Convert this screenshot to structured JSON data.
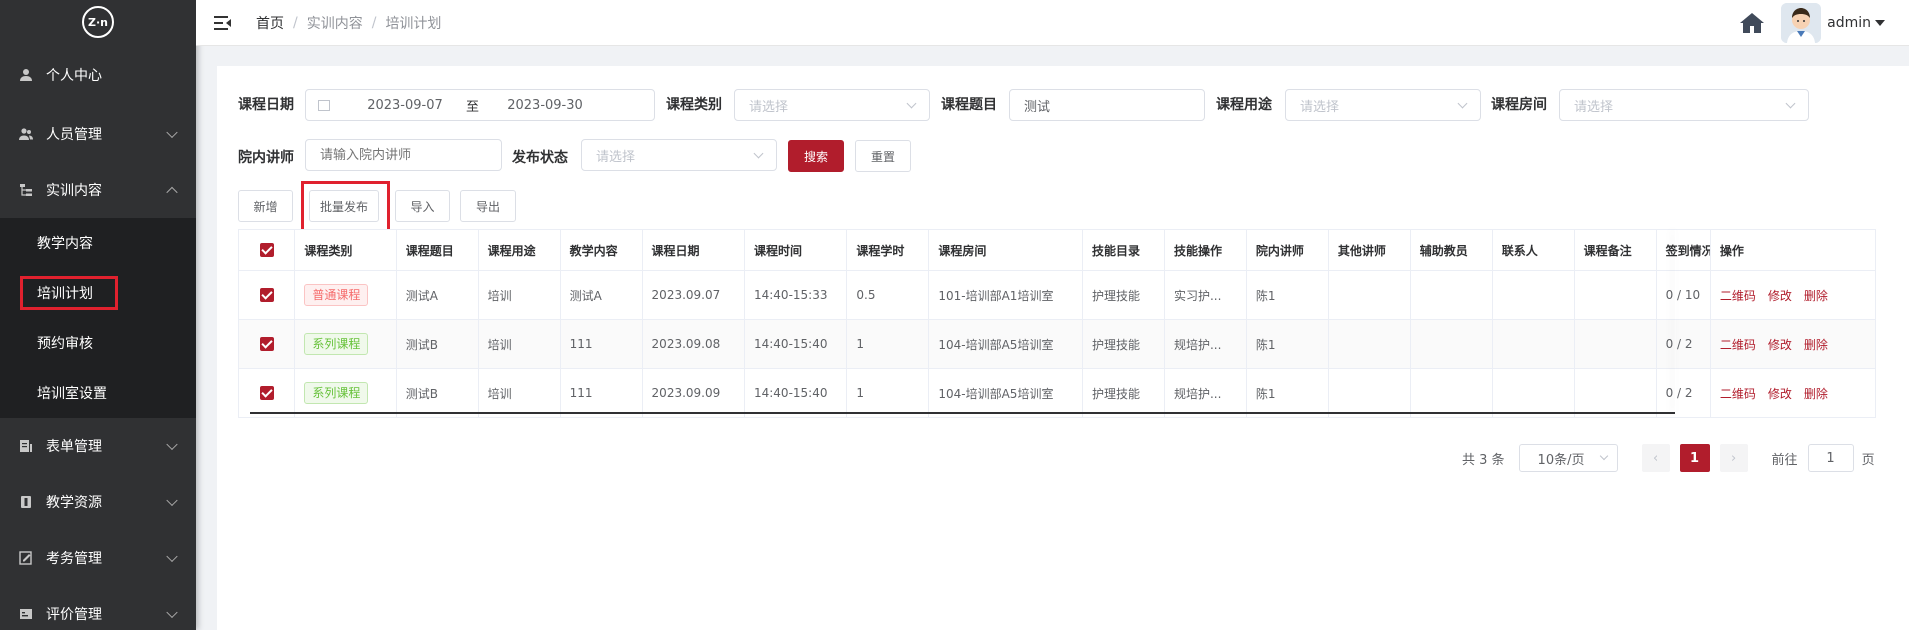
{
  "logo": {
    "text": "Z·n"
  },
  "sidebar": {
    "items": [
      {
        "label": "个人中心",
        "icon": "user-icon"
      },
      {
        "label": "人员管理",
        "icon": "users-icon"
      },
      {
        "label": "实训内容",
        "icon": "tree-icon",
        "expanded": true,
        "children": [
          "教学内容",
          "培训计划",
          "预约审核",
          "培训室设置"
        ]
      },
      {
        "label": "表单管理",
        "icon": "form-icon"
      },
      {
        "label": "教学资源",
        "icon": "book-icon"
      },
      {
        "label": "考务管理",
        "icon": "exam-icon"
      },
      {
        "label": "评价管理",
        "icon": "rating-icon"
      }
    ],
    "active_child": "培训计划"
  },
  "breadcrumb": [
    "首页",
    "实训内容",
    "培训计划"
  ],
  "breadcrumb_sep": "/",
  "user": {
    "name": "admin"
  },
  "filters": {
    "date_label": "课程日期",
    "date_start": "2023-09-07",
    "date_to": "至",
    "date_end": "2023-09-30",
    "category_label": "课程类别",
    "category_placeholder": "请选择",
    "topic_label": "课程题目",
    "topic_value": "测试",
    "purpose_label": "课程用途",
    "purpose_placeholder": "请选择",
    "room_label": "课程房间",
    "room_placeholder": "请选择",
    "lecturer_label": "院内讲师",
    "lecturer_placeholder": "请输入院内讲师",
    "status_label": "发布状态",
    "status_placeholder": "请选择",
    "search_btn": "搜索",
    "reset_btn": "重置"
  },
  "toolbar": {
    "add": "新增",
    "batch_publish": "批量发布",
    "import": "导入",
    "export": "导出"
  },
  "table": {
    "headers": [
      "课程类别",
      "课程题目",
      "课程用途",
      "教学内容",
      "课程日期",
      "课程时间",
      "课程学时",
      "课程房间",
      "技能目录",
      "技能操作",
      "院内讲师",
      "其他讲师",
      "辅助教员",
      "联系人",
      "课程备注",
      "签到情况",
      "操作"
    ],
    "rows": [
      {
        "category": "普通课程",
        "tag": "red",
        "topic": "测试A",
        "purpose": "培训",
        "content": "测试A",
        "date": "2023.09.07",
        "time": "14:40-15:33",
        "hours": "0.5",
        "room": "101-培训部A1培训室",
        "skill_dir": "护理技能",
        "skill_op": "实习护...",
        "lecturer": "陈1",
        "other": "",
        "assist": "",
        "contact": "",
        "note": "",
        "signin": "0 / 10"
      },
      {
        "category": "系列课程",
        "tag": "green",
        "topic": "测试B",
        "purpose": "培训",
        "content": "111",
        "date": "2023.09.08",
        "time": "14:40-15:40",
        "hours": "1",
        "room": "104-培训部A5培训室",
        "skill_dir": "护理技能",
        "skill_op": "规培护...",
        "lecturer": "陈1",
        "other": "",
        "assist": "",
        "contact": "",
        "note": "",
        "signin": "0 / 2"
      },
      {
        "category": "系列课程",
        "tag": "green",
        "topic": "测试B",
        "purpose": "培训",
        "content": "111",
        "date": "2023.09.09",
        "time": "14:40-15:40",
        "hours": "1",
        "room": "104-培训部A5培训室",
        "skill_dir": "护理技能",
        "skill_op": "规培护...",
        "lecturer": "陈1",
        "other": "",
        "assist": "",
        "contact": "",
        "note": "",
        "signin": "0 / 2"
      }
    ],
    "ops": [
      "二维码",
      "修改",
      "删除"
    ]
  },
  "pagination": {
    "total": "共 3 条",
    "page_size": "10条/页",
    "current": "1",
    "goto_label": "前往",
    "goto_value": "1",
    "page_suffix": "页"
  },
  "colors": {
    "primary": "#b11d2c",
    "sidebar": "#303133",
    "highlight": "#e0212e"
  }
}
